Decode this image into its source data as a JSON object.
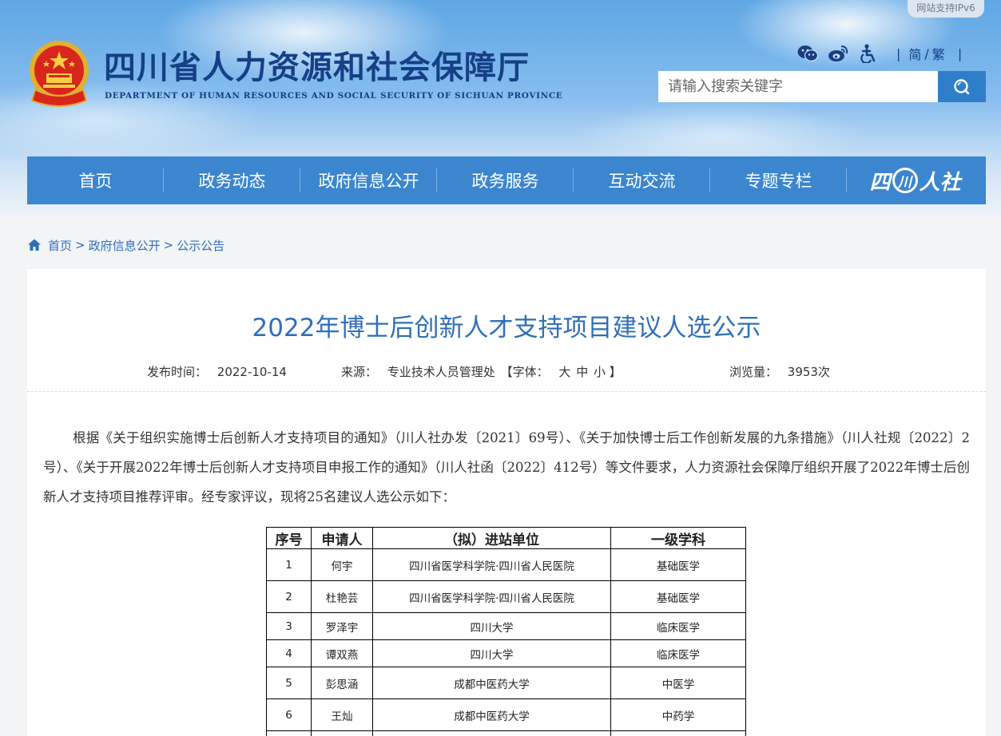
{
  "header": {
    "ipv6_badge": "网站支持IPv6",
    "site_title": "四川省人力资源和社会保障厅",
    "site_subtitle": "DEPARTMENT OF HUMAN RESOURCES AND SOCIAL SECURITY OF SICHUAN PROVINCE",
    "tools": {
      "icons": [
        "wechat-icon",
        "weibo-icon",
        "accessibility-icon"
      ],
      "lang_simplified": "简",
      "lang_divider": "/",
      "lang_traditional": "繁",
      "separator": "|"
    },
    "search": {
      "placeholder": "请输入搜索关键字",
      "value": ""
    },
    "colors": {
      "title_blue": "#163f86",
      "nav_blue": "#3b86cf",
      "search_btn": "#2f7ec9",
      "link_blue": "#2f6fb8"
    }
  },
  "nav": {
    "items": [
      {
        "label": "首页"
      },
      {
        "label": "政务动态"
      },
      {
        "label": "政府信息公开"
      },
      {
        "label": "政务服务"
      },
      {
        "label": "互动交流"
      },
      {
        "label": "专题专栏"
      }
    ],
    "brand": {
      "text_left": "四",
      "text_ring": "川",
      "text_right": "人社"
    }
  },
  "breadcrumb": {
    "items": [
      "首页",
      "政府信息公开",
      "公示公告"
    ],
    "separator": ">"
  },
  "article": {
    "title": "2022年博士后创新人才支持项目建议人选公示",
    "meta": {
      "date_label": "发布时间：",
      "date": "2022-10-14",
      "source_label": "来源：",
      "source": "专业技术人员管理处",
      "font_open": "【字体：",
      "font_large": "大",
      "font_medium": "中",
      "font_small": "小",
      "font_close": "】",
      "views_label": "浏览量：",
      "views": "3953次"
    },
    "paragraph": "根据《关于组织实施博士后创新人才支持项目的通知》（川人社办发〔2021〕69号）、《关于加快博士后工作创新发展的九条措施》（川人社规〔2022〕2号）、《关于开展2022年博士后创新人才支持项目申报工作的通知》（川人社函〔2022〕412号）等文件要求，人力资源社会保障厅组织开展了2022年博士后创新人才支持项目推荐评审。经专家评议，现将25名建议人选公示如下：",
    "table": {
      "headers": [
        "序号",
        "申请人",
        "（拟）进站单位",
        "一级学科"
      ],
      "rows": [
        {
          "no": "1",
          "name": "何宇",
          "unit": "四川省医学科学院·四川省人民医院",
          "discipline": "基础医学"
        },
        {
          "no": "2",
          "name": "杜艳芸",
          "unit": "四川省医学科学院·四川省人民医院",
          "discipline": "基础医学"
        },
        {
          "no": "3",
          "name": "罗泽宇",
          "unit": "四川大学",
          "discipline": "临床医学"
        },
        {
          "no": "4",
          "name": "谭双燕",
          "unit": "四川大学",
          "discipline": "临床医学"
        },
        {
          "no": "5",
          "name": "彭思涵",
          "unit": "成都中医药大学",
          "discipline": "中医学"
        },
        {
          "no": "6",
          "name": "王灿",
          "unit": "成都中医药大学",
          "discipline": "中药学"
        },
        {
          "no": "",
          "name": "",
          "unit": "",
          "discipline": ""
        }
      ]
    }
  }
}
